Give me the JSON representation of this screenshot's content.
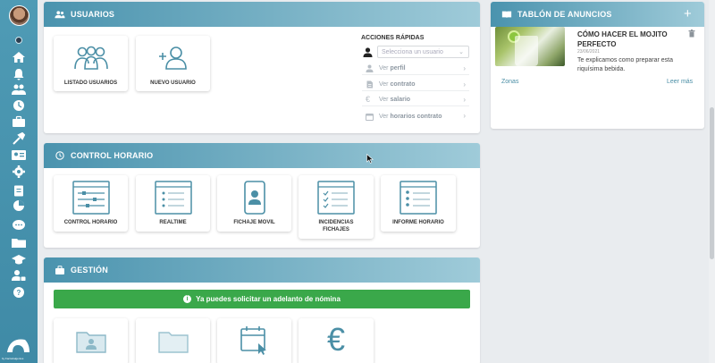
{
  "sidebar": {
    "icons": [
      "home-icon",
      "bell-icon",
      "users-icon",
      "clock-icon",
      "briefcase-icon",
      "tool-icon",
      "id-card-icon",
      "gear-icon",
      "clipboard-icon",
      "pie-chart-icon",
      "chat-icon",
      "folder-icon",
      "graduation-cap-icon",
      "user-lock-icon",
      "help-icon"
    ],
    "brand_text": "by Factorialgenius"
  },
  "usuarios": {
    "title": "USUARIOS",
    "tiles": [
      {
        "label": "LISTADO USUARIOS"
      },
      {
        "label": "NUEVO USUARIO"
      }
    ],
    "quick": {
      "title": "ACCIONES RÁPIDAS",
      "select_placeholder": "Selecciona un usuario",
      "rows": [
        {
          "prefix": "Ver",
          "bold": "perfil"
        },
        {
          "prefix": "Ver",
          "bold": "contrato"
        },
        {
          "prefix": "Ver",
          "bold": "salario"
        },
        {
          "prefix": "Ver",
          "bold": "horarios contrato"
        }
      ]
    }
  },
  "control": {
    "title": "CONTROL HORARIO",
    "tiles": [
      {
        "label": "CONTROL HORARIO"
      },
      {
        "label": "REALTIME"
      },
      {
        "label": "FICHAJE MOVIL"
      },
      {
        "label": "INCIDENCIAS FICHAJES"
      },
      {
        "label": "INFORME HORARIO"
      }
    ]
  },
  "gestion": {
    "title": "GESTIÓN",
    "alert": "Ya puedes solicitar un adelanto de nómina"
  },
  "tablon": {
    "title": "TABLÓN DE ANUNCIOS",
    "post": {
      "title": "CÓMO HACER EL MOJITO PERFECTO",
      "date": "23/06/2021",
      "text": "Te explicamos como preparar esta riquísima bebida.",
      "tag": "Zonas",
      "more": "Leer más"
    }
  },
  "colors": {
    "accent": "#4a93ae",
    "success": "#3aa84a",
    "icon": "#4b8fa6"
  }
}
